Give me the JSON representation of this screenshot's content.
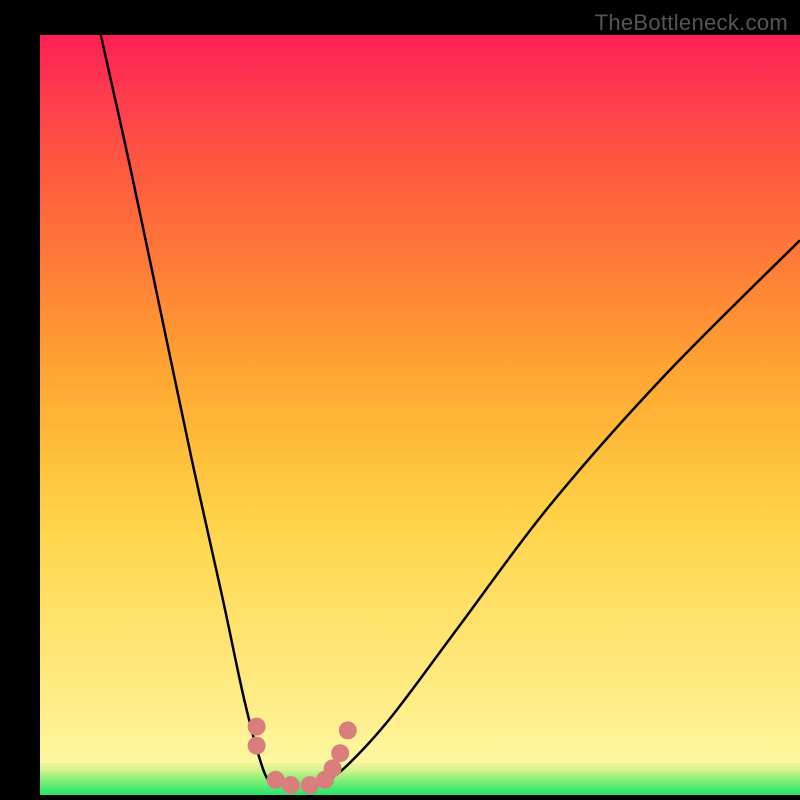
{
  "watermark": "TheBottleneck.com",
  "chart_data": {
    "type": "line",
    "title": "",
    "xlabel": "",
    "ylabel": "",
    "xlim": [
      0,
      760
    ],
    "ylim": [
      0,
      760
    ],
    "x_is_normalized_position": true,
    "y_is_normalized_bottleneck": true,
    "notes": "Plot area uses a vertical red→yellow→green gradient indicating bottleneck severity (top=high, bottom=low). Two black curves form a V trough near x≈0.30–0.40 with red dot markers along the trough floor.",
    "series": [
      {
        "name": "left-curve",
        "stroke": "#000000",
        "x": [
          0.08,
          0.12,
          0.16,
          0.2,
          0.24,
          0.27,
          0.295,
          0.31
        ],
        "y": [
          1.0,
          0.82,
          0.63,
          0.44,
          0.26,
          0.12,
          0.03,
          0.015
        ]
      },
      {
        "name": "right-curve",
        "stroke": "#000000",
        "x": [
          0.37,
          0.4,
          0.46,
          0.55,
          0.67,
          0.82,
          1.0
        ],
        "y": [
          0.015,
          0.035,
          0.1,
          0.22,
          0.38,
          0.55,
          0.73
        ]
      },
      {
        "name": "trough-markers",
        "marker_color": "#d97d7d",
        "x": [
          0.285,
          0.285,
          0.31,
          0.33,
          0.355,
          0.375,
          0.385,
          0.395,
          0.405
        ],
        "y": [
          0.09,
          0.065,
          0.02,
          0.013,
          0.013,
          0.02,
          0.035,
          0.055,
          0.085
        ]
      }
    ]
  }
}
